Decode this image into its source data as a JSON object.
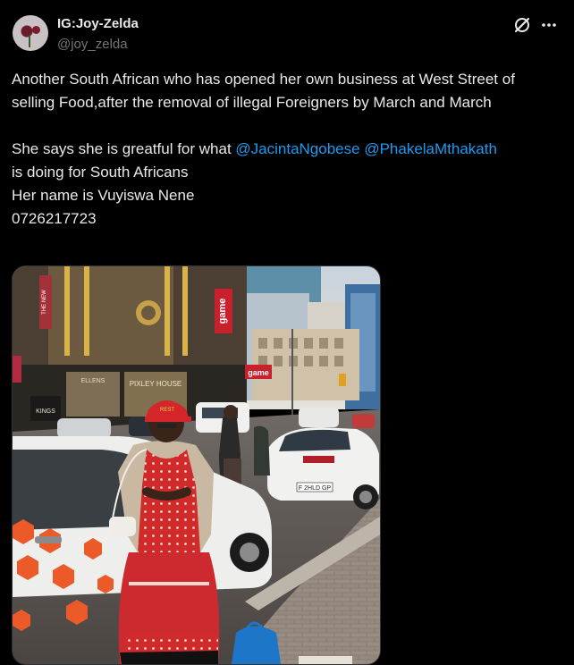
{
  "author": {
    "display_name": "IG:Joy-Zelda",
    "handle": "@joy_zelda",
    "avatar_icon": "rose-avatar"
  },
  "header_actions": {
    "grok_icon": "grok-icon",
    "more_icon": "more-icon"
  },
  "tweet": {
    "line1": "Another South African who has opened her own business at West Street of selling Food,after the removal of illegal Foreigners by March and March",
    "line2_prefix": "She says she is greatful for what ",
    "mention1": "@JacintaNgobese",
    "mention2": "@PhakelaMthakath",
    "line2_suffix": "is doing for South Africans",
    "line3": "Her name is Vuyiswa Nene",
    "line4": "0726217723"
  },
  "media": {
    "sign_game": "game",
    "sign_kings": "KINGS",
    "sign_pixley": "PIXLEY HOUSE",
    "sign_ellens": "ELLENS",
    "sign_newspaper": "THE NEW",
    "plate": "F 2HLD GP",
    "cap_text": "REST",
    "colors": {
      "apron": "#d02a2a",
      "cap": "#d4262a",
      "sky": "#c9d3dc"
    }
  },
  "colors": {
    "background": "#000000",
    "text": "#e7e9ea",
    "muted": "#71767b",
    "link": "#1d9bf0"
  }
}
